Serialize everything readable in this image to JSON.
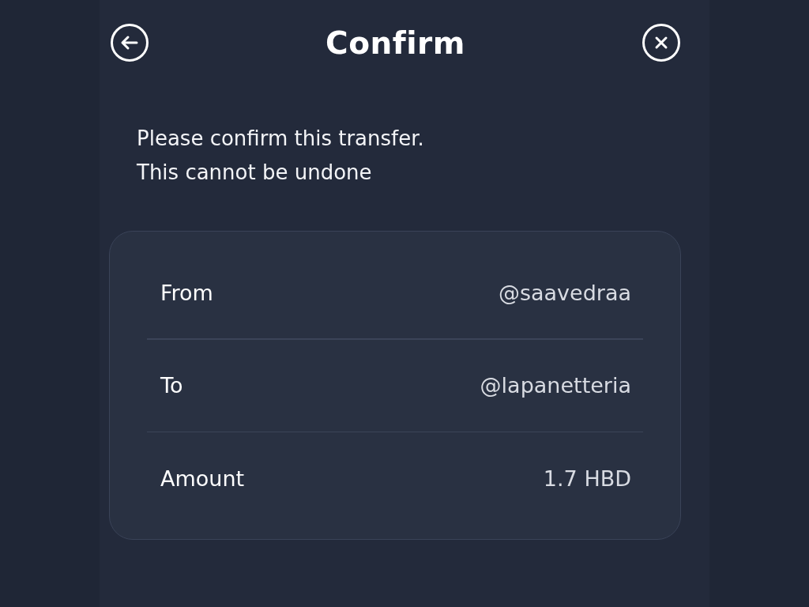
{
  "header": {
    "title": "Confirm"
  },
  "message": [
    "Please confirm this transfer.",
    "This cannot be undone"
  ],
  "details": [
    {
      "label": "From",
      "value": "@saavedraa"
    },
    {
      "label": "To",
      "value": "@lapanetteria"
    },
    {
      "label": "Amount",
      "value": "1.7 HBD"
    }
  ]
}
